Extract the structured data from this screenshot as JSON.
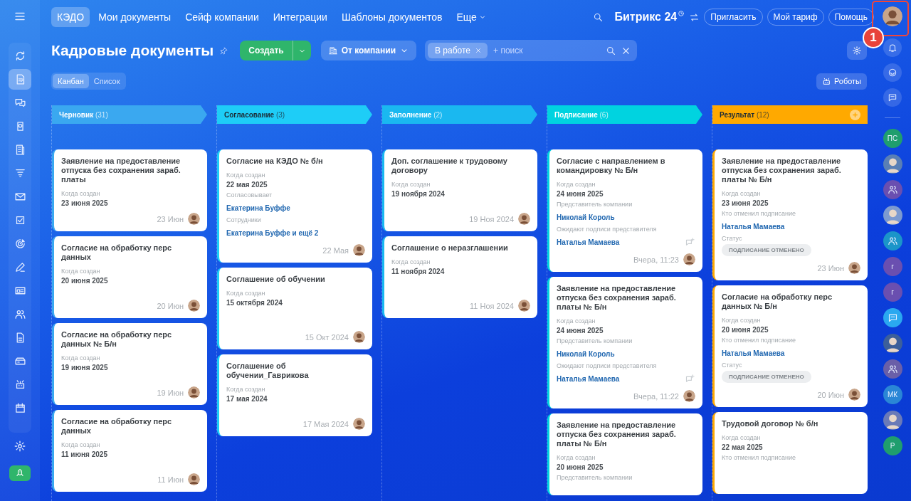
{
  "top_bar": {
    "tabs": [
      {
        "label": "КЭДО",
        "selected": true
      },
      {
        "label": "Мои документы",
        "selected": false
      },
      {
        "label": "Сейф компании",
        "selected": false
      },
      {
        "label": "Интеграции",
        "selected": false
      },
      {
        "label": "Шаблоны документов",
        "selected": false
      },
      {
        "label": "Еще",
        "selected": false
      }
    ],
    "logo": "Битрикс 24",
    "buttons": [
      "Пригласить",
      "Мой тариф",
      "Помощь"
    ]
  },
  "annotation": {
    "number": "1"
  },
  "left_sidebar": {
    "items": [
      {
        "selected": false
      },
      {
        "selected": true
      },
      {
        "selected": false
      },
      {
        "selected": false
      },
      {
        "selected": false
      },
      {
        "selected": false
      },
      {
        "selected": false
      },
      {
        "selected": false
      },
      {
        "selected": false
      },
      {
        "selected": false
      },
      {
        "selected": false
      },
      {
        "selected": false
      },
      {
        "selected": false
      },
      {
        "selected": false
      },
      {
        "selected": false
      },
      {
        "selected": false
      }
    ]
  },
  "header": {
    "title": "Кадровые документы",
    "create_button": "Создать",
    "scope_dropdown": "От компании",
    "filter_chip": "В работе",
    "search": {
      "placeholder": "+ поиск"
    }
  },
  "view_tabs": [
    {
      "label": "Канбан",
      "selected": true
    },
    {
      "label": "Список",
      "selected": false
    }
  ],
  "robots_button": "Роботы",
  "columns": [
    {
      "name": "Черновик",
      "count": "(31)",
      "color": "#3aa8f0",
      "cards": [
        {
          "title": "Заявление на предоставление отпуска без сохранения зараб. платы",
          "fields": [
            {
              "label": "Когда создан",
              "value": "23 июня 2025",
              "kind": "date"
            }
          ],
          "footer": "23 Июн",
          "chat_icon": false
        },
        {
          "title": "Согласие на обработку перс данных",
          "fields": [
            {
              "label": "Когда создан",
              "value": "20 июня 2025",
              "kind": "date"
            }
          ],
          "footer": "20 Июн",
          "chat_icon": false
        },
        {
          "title": "Согласие на обработку перс данных № Б/н",
          "fields": [
            {
              "label": "Когда создан",
              "value": "19 июня 2025",
              "kind": "date"
            }
          ],
          "footer": "19 Июн",
          "chat_icon": false
        },
        {
          "title": "Согласие на обработку перс данных",
          "fields": [
            {
              "label": "Когда создан",
              "value": "11 июня 2025",
              "kind": "date"
            }
          ],
          "footer": "11 Июн",
          "chat_icon": false
        }
      ]
    },
    {
      "name": "Согласование",
      "count": "(3)",
      "color": "#1ecdf7",
      "cards": [
        {
          "title": "Согласие на КЭДО № б/н",
          "fields": [
            {
              "label": "Когда создан",
              "value": "22 мая 2025",
              "kind": "date"
            },
            {
              "label": "Согласовывает",
              "value": "Екатерина Буффе",
              "kind": "link"
            },
            {
              "label": "Сотрудники",
              "value": "Екатерина Буффе и ещё 2",
              "kind": "link"
            }
          ],
          "footer": "22 Мая",
          "chat_icon": false
        },
        {
          "title": "Соглашение об обучении",
          "fields": [
            {
              "label": "Когда создан",
              "value": "15 октября 2024",
              "kind": "date"
            }
          ],
          "footer": "15 Окт 2024",
          "chat_icon": false
        },
        {
          "title": "Соглашение об обучении_Гаврикова",
          "fields": [
            {
              "label": "Когда создан",
              "value": "17 мая 2024",
              "kind": "date"
            }
          ],
          "footer": "17 Мая 2024",
          "chat_icon": false
        }
      ]
    },
    {
      "name": "Заполнение",
      "count": "(2)",
      "color": "#1ab8f0",
      "cards": [
        {
          "title": "Доп. соглашение к трудовому договору",
          "fields": [
            {
              "label": "Когда создан",
              "value": "19 ноября 2024",
              "kind": "date"
            }
          ],
          "footer": "19 Ноя 2024",
          "chat_icon": false
        },
        {
          "title": "Соглашение о неразглашении",
          "fields": [
            {
              "label": "Когда создан",
              "value": "11 ноября 2024",
              "kind": "date"
            }
          ],
          "footer": "11 Ноя 2024",
          "chat_icon": false
        }
      ]
    },
    {
      "name": "Подписание",
      "count": "(6)",
      "color": "#00d3e0",
      "cards": [
        {
          "title": "Согласие с направлением в командировку № Б/н",
          "fields": [
            {
              "label": "Когда создан",
              "value": "24 июня 2025",
              "kind": "date"
            },
            {
              "label": "Представитель компании",
              "value": "Николай Король",
              "kind": "link"
            },
            {
              "label": "Ожидают подписи представителя",
              "value": "Наталья Мамаева",
              "kind": "link"
            }
          ],
          "footer": "Вчера, 11:23",
          "chat_icon": true
        },
        {
          "title": "Заявление на предоставление отпуска без сохранения зараб. платы № Б/н",
          "fields": [
            {
              "label": "Когда создан",
              "value": "24 июня 2025",
              "kind": "date"
            },
            {
              "label": "Представитель компании",
              "value": "Николай Король",
              "kind": "link"
            },
            {
              "label": "Ожидают подписи представителя",
              "value": "Наталья Мамаева",
              "kind": "link"
            }
          ],
          "footer": "Вчера, 11:22",
          "chat_icon": true
        },
        {
          "title": "Заявление на предоставление отпуска без сохранения зараб. платы № Б/н",
          "fields": [
            {
              "label": "Когда создан",
              "value": "20 июня 2025",
              "kind": "date"
            },
            {
              "label": "Представитель компании",
              "kind": "label"
            }
          ],
          "chat_icon": false
        }
      ]
    },
    {
      "name": "Результат",
      "count": "(12)",
      "color": "#ffa900",
      "cards": [
        {
          "title": "Заявление на предоставление отпуска без сохранения зараб. платы № Б/н",
          "fields": [
            {
              "label": "Когда создан",
              "value": "23 июня 2025",
              "kind": "date"
            },
            {
              "label": "Кто отменил подписание",
              "value": "Наталья Мамаева",
              "kind": "link"
            },
            {
              "label": "Статус",
              "value": "ПОДПИСАНИЕ ОТМЕНЕНО",
              "kind": "badge"
            }
          ],
          "footer": "23 Июн",
          "chat_icon": false
        },
        {
          "title": "Согласие на обработку перс данных № Б/н",
          "fields": [
            {
              "label": "Когда создан",
              "value": "20 июня 2025",
              "kind": "date"
            },
            {
              "label": "Кто отменил подписание",
              "value": "Наталья Мамаева",
              "kind": "link"
            },
            {
              "label": "Статус",
              "value": "ПОДПИСАНИЕ ОТМЕНЕНО",
              "kind": "badge"
            }
          ],
          "footer": "20 Июн",
          "chat_icon": false
        },
        {
          "title": "Трудовой договор № б/н",
          "fields": [
            {
              "label": "Когда создан",
              "value": "22 мая 2025",
              "kind": "date"
            },
            {
              "label": "Кто отменил подписание",
              "kind": "label"
            }
          ],
          "chat_icon": false
        }
      ]
    }
  ],
  "right_sidebar": {
    "contacts": [
      {
        "kind": "initials",
        "text": "ПС",
        "color": "#1f9e6e"
      },
      {
        "kind": "avatar",
        "color": "#5a7fb5"
      },
      {
        "kind": "group",
        "color": "#6a4fb0"
      },
      {
        "kind": "avatar",
        "color": "#7d9ad0"
      },
      {
        "kind": "group",
        "color": "#1b95c9"
      },
      {
        "kind": "initials",
        "text": "г",
        "color": "#6a4fb0"
      },
      {
        "kind": "initials",
        "text": "г",
        "color": "#6a4fb0"
      },
      {
        "kind": "chat",
        "color": "#2aa8f0"
      },
      {
        "kind": "avatar",
        "color": "#3c5f9a"
      },
      {
        "kind": "group",
        "color": "#6a5fa8"
      },
      {
        "kind": "initials",
        "text": "МК",
        "color": "#2a86d6"
      },
      {
        "kind": "avatar",
        "color": "#6a7ab8"
      },
      {
        "kind": "initials",
        "text": "Р",
        "color": "#1f9e6e"
      }
    ]
  }
}
